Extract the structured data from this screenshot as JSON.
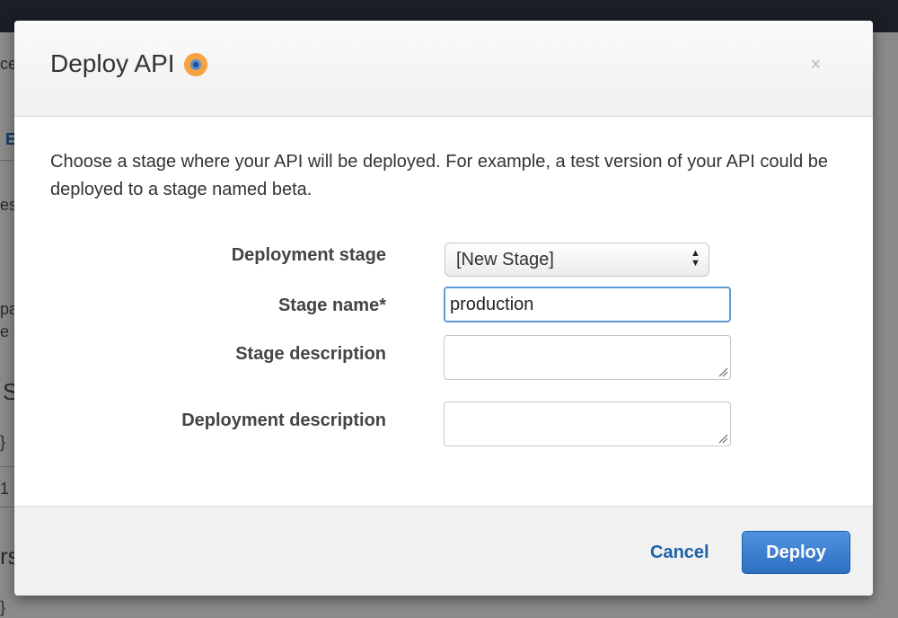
{
  "background": {
    "fragments": [
      "ce",
      "E",
      "es",
      "pa",
      "e s",
      "S",
      "}",
      "1",
      "rs",
      "}"
    ]
  },
  "modal": {
    "title": "Deploy API",
    "info_icon": "info-icon",
    "close_label": "×",
    "intro_text": "Choose a stage where your API will be deployed. For example, a test version of your API could be deployed to a stage named beta.",
    "fields": {
      "deployment_stage_label": "Deployment stage",
      "deployment_stage_value": "[New Stage]",
      "stage_name_label": "Stage name*",
      "stage_name_value": "production",
      "stage_description_label": "Stage description",
      "stage_description_value": "",
      "deployment_description_label": "Deployment description",
      "deployment_description_value": ""
    },
    "footer": {
      "cancel_label": "Cancel",
      "deploy_label": "Deploy"
    }
  },
  "colors": {
    "accent": "#2e6fc1",
    "link": "#1f62a8",
    "info_icon_orange": "#f7a23e",
    "focus_border": "#5e9bd6"
  }
}
